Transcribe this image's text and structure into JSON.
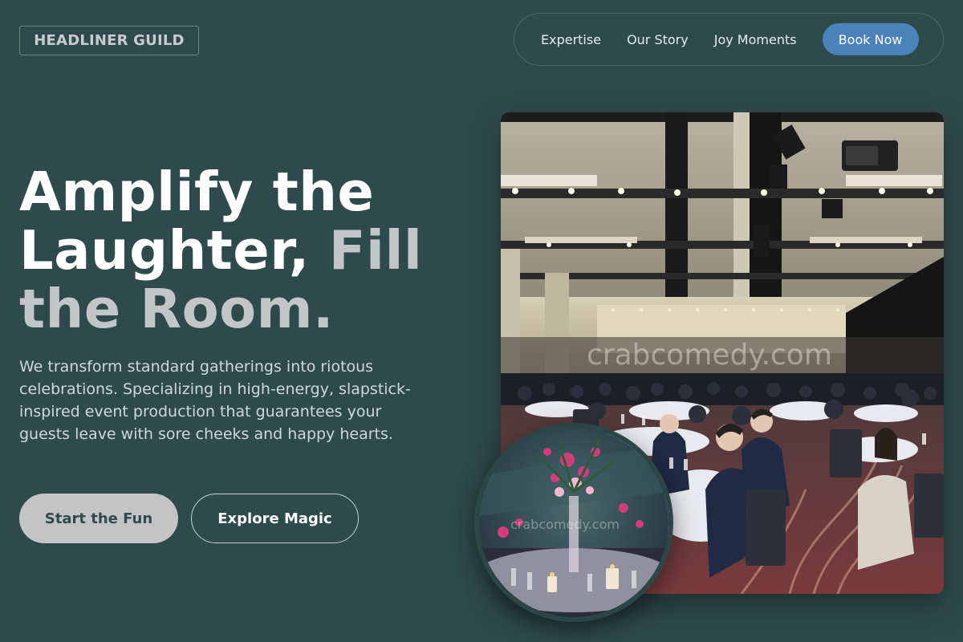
{
  "brand": {
    "name": "HEADLINER GUILD"
  },
  "nav": {
    "links": [
      "Expertise",
      "Our Story",
      "Joy Moments"
    ],
    "cta": "Book Now"
  },
  "hero": {
    "headline_white": "Amplify the Laughter,",
    "headline_muted": "Fill the Room.",
    "description": "We transform standard gatherings into riotous celebrations. Specializing in high-energy, slapstick-inspired event production that guarantees your guests leave with sore cheeks and happy hearts.",
    "primary_button": "Start the Fun",
    "secondary_button": "Explore Magic"
  },
  "images": {
    "main_watermark": "crabcomedy.com",
    "circle_watermark": "crabcomedy.com"
  },
  "colors": {
    "background": "#2f4a4b",
    "accent": "#4a82b9",
    "primary_button": "#c4c4c4",
    "muted_text": "#c3c6c6"
  }
}
